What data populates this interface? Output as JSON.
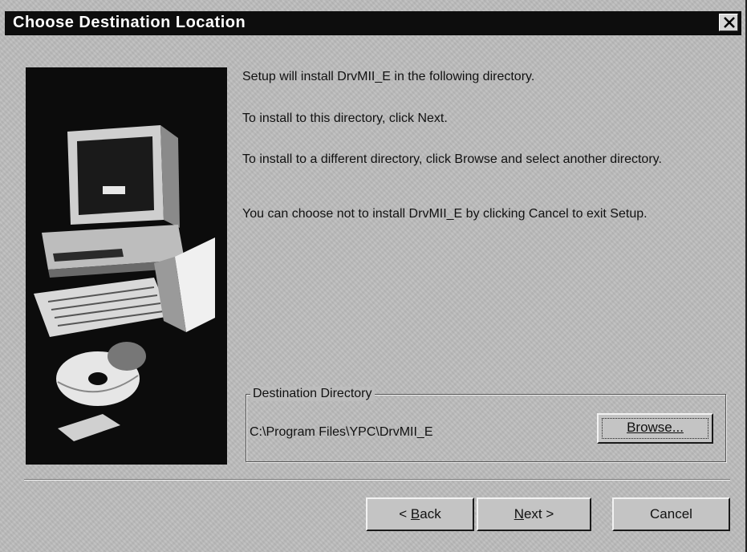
{
  "window": {
    "title": "Choose Destination Location"
  },
  "messages": {
    "line1": "Setup will install DrvMII_E in the following directory.",
    "line2": "To install to this directory, click Next.",
    "line3": "To install to a different directory, click Browse and select another directory.",
    "line4": "You can choose not to install DrvMII_E by clicking Cancel to exit Setup."
  },
  "destination": {
    "legend": "Destination Directory",
    "path": "C:\\Program Files\\YPC\\DrvMII_E",
    "browse_label": "Browse..."
  },
  "buttons": {
    "back_prefix": "< ",
    "back_key": "B",
    "back_rest": "ack",
    "next_key": "N",
    "next_rest": "ext >",
    "cancel": "Cancel"
  },
  "icons": {
    "close": "close-icon",
    "illustration": "computer-setup-illustration"
  }
}
